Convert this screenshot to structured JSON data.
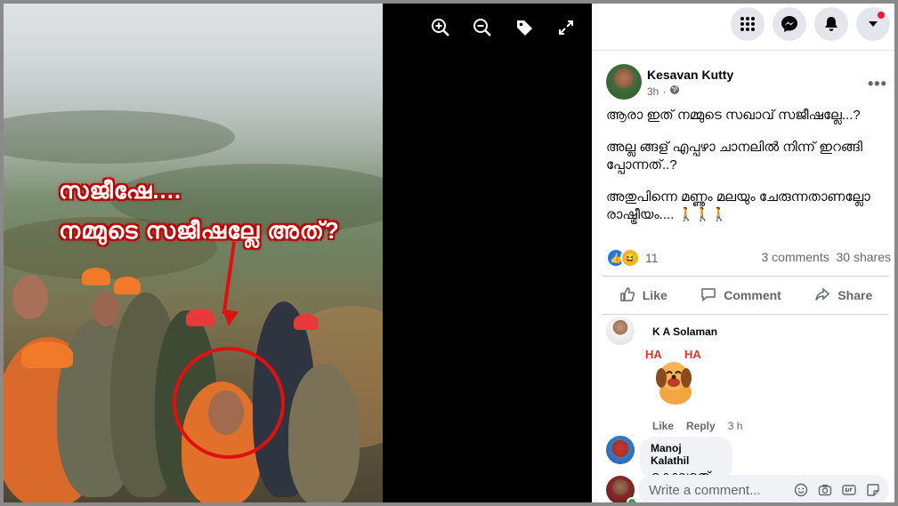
{
  "photo": {
    "overlay_line1": "സജീഷേ....",
    "overlay_line2": "നമ്മുടെ സജീഷല്ലേ അത്?"
  },
  "viewer_toolbar": {
    "icons": [
      "zoom-in-icon",
      "zoom-out-icon",
      "tag-icon",
      "fullscreen-icon"
    ]
  },
  "topbar": {
    "icons": [
      "menu-grid-icon",
      "messenger-icon",
      "bell-icon",
      "account-dropdown-icon"
    ],
    "notification_color": "#e41e3f"
  },
  "post": {
    "author": "Kesavan Kutty",
    "time": "3h",
    "privacy_icon": "globe-icon",
    "text_p1": "ആരാ ഇത് നമ്മുടെ സഖാവ് സജീഷല്ലേ...?",
    "text_p2": "അല്ല ങ്ങള് എപ്പഴാ ചാനലിൽ നിന്ന് ഇറങ്ങി പ്പോന്നത്..?",
    "text_p3": "അതുപിന്നെ മണ്ണും മലയും ചേരുന്നതാണല്ലോ രാഷ്ട്രീയം.... 🚶🚶🚶",
    "reaction_count": "11",
    "comments_count": "3 comments",
    "shares_count": "30 shares",
    "like_label": "Like",
    "comment_label": "Comment",
    "share_label": "Share"
  },
  "comments": [
    {
      "name": "K A Solaman",
      "sticker_text": "HA HA",
      "like": "Like",
      "reply": "Reply",
      "time": "3 h"
    },
    {
      "name": "Manoj Kalathil",
      "text": "കൊലരത്"
    }
  ],
  "write_comment": {
    "placeholder": "Write a comment...",
    "icons": [
      "emoji-icon",
      "camera-icon",
      "gif-icon",
      "sticker-icon"
    ]
  },
  "colors": {
    "fb_blue": "#1877f2",
    "overlay_red": "#e01010"
  }
}
